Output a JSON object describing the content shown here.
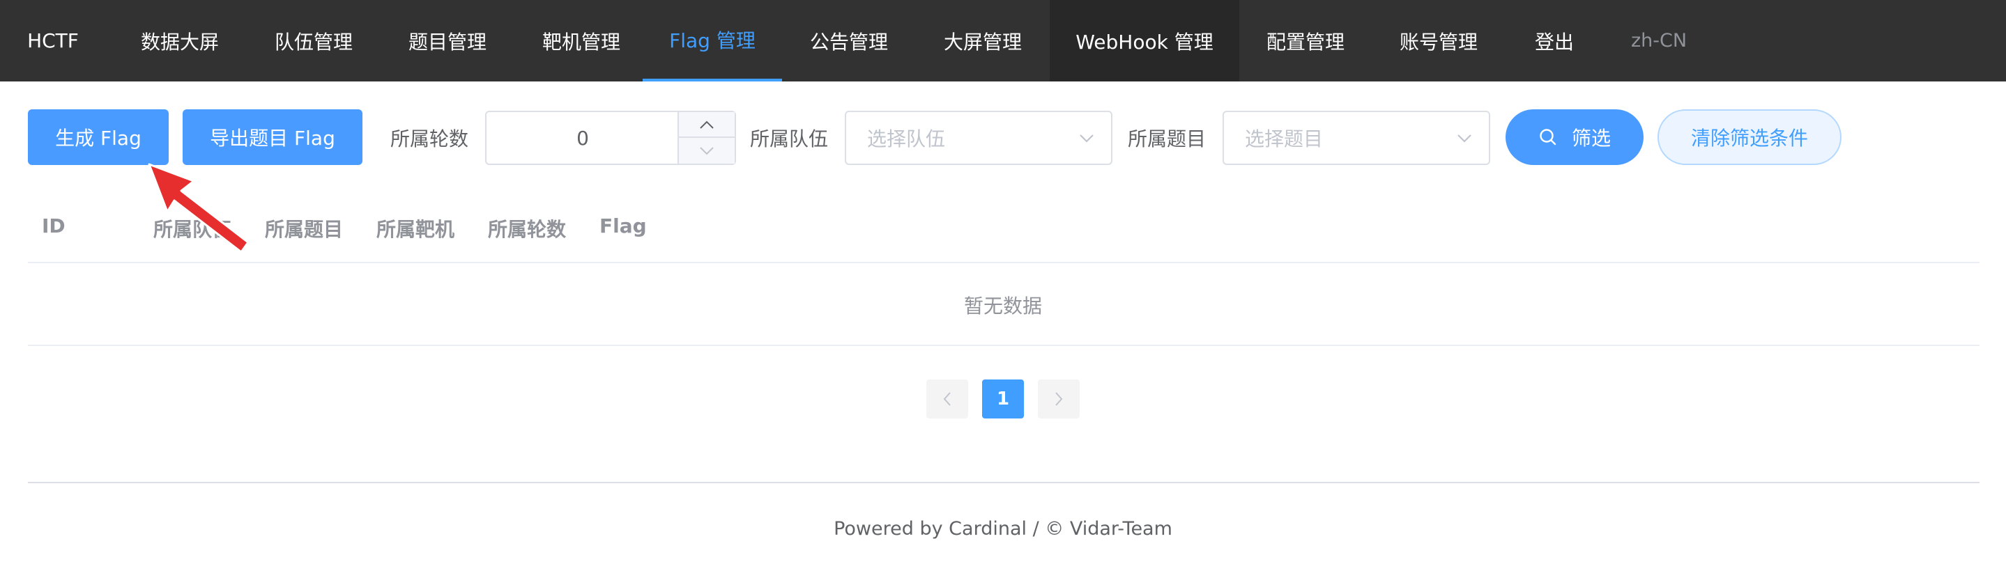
{
  "nav": {
    "items": [
      {
        "label": "HCTF"
      },
      {
        "label": "数据大屏"
      },
      {
        "label": "队伍管理"
      },
      {
        "label": "题目管理"
      },
      {
        "label": "靶机管理"
      },
      {
        "label": "Flag 管理"
      },
      {
        "label": "公告管理"
      },
      {
        "label": "大屏管理"
      },
      {
        "label": "WebHook 管理"
      },
      {
        "label": "配置管理"
      },
      {
        "label": "账号管理"
      },
      {
        "label": "登出"
      }
    ],
    "active": "Flag 管理",
    "language": "zh-CN"
  },
  "toolbar": {
    "generate_label": "生成 Flag",
    "export_label": "导出题目 Flag",
    "round_label": "所属轮数",
    "round_value": "0",
    "team_label": "所属队伍",
    "team_placeholder": "选择队伍",
    "challenge_label": "所属题目",
    "challenge_placeholder": "选择题目",
    "filter_label": "筛选",
    "clear_label": "清除筛选条件"
  },
  "table": {
    "columns": [
      "ID",
      "所属队伍",
      "所属题目",
      "所属靶机",
      "所属轮数",
      "Flag"
    ],
    "empty_text": "暂无数据"
  },
  "pagination": {
    "current_page": "1"
  },
  "footer": {
    "text": "Powered by Cardinal / © Vidar-Team"
  },
  "colors": {
    "nav_bg": "#323232",
    "accent": "#409EFF",
    "annotation_arrow": "#e62e2e"
  }
}
